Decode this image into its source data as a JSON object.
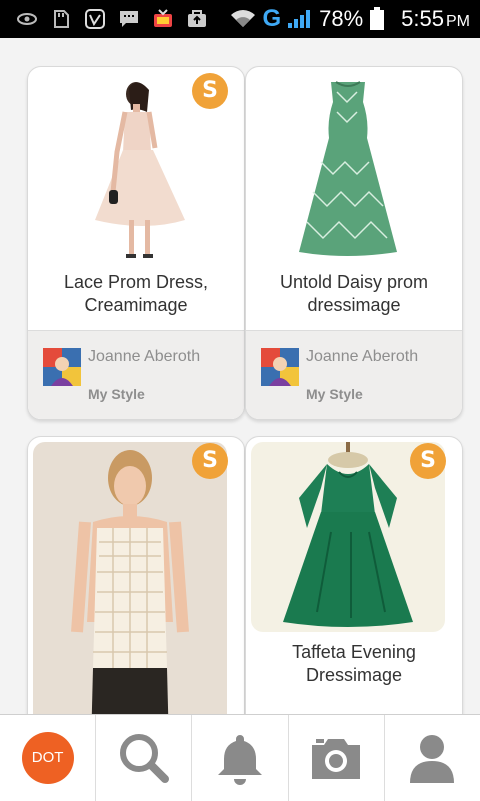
{
  "status_bar": {
    "battery": "78%",
    "time": "5:55",
    "ampm": "PM",
    "network": "G",
    "left_icons": [
      "eye-icon",
      "sd-card-icon",
      "vine-icon",
      "message-icon",
      "tv-app-icon",
      "briefcase-upload-icon"
    ],
    "right_icons": [
      "wifi-icon",
      "signal-icon",
      "battery-icon"
    ]
  },
  "feed": {
    "cards": [
      {
        "title": "Lace Prom Dress, Creamimage",
        "badge": "S",
        "author": "Joanne Aberoth",
        "board": "My Style",
        "image": "pink-lace-dress-model"
      },
      {
        "title": "Untold Daisy prom dressimage",
        "badge": "S",
        "author": "Joanne Aberoth",
        "board": "My Style",
        "image": "green-daisy-dress"
      },
      {
        "title": "",
        "badge": "S",
        "image": "cream-lace-top-model"
      },
      {
        "title": "Taffeta Evening Dressimage",
        "badge": "S",
        "image": "green-taffeta-dress"
      }
    ]
  },
  "bottom_nav": {
    "items": [
      {
        "label": "DOT",
        "icon": "dot-logo"
      },
      {
        "icon": "search-icon"
      },
      {
        "icon": "bell-icon"
      },
      {
        "icon": "camera-icon"
      },
      {
        "icon": "profile-icon"
      }
    ]
  },
  "colors": {
    "badge": "#f0a238",
    "dot_button": "#ee6123",
    "nav_icon": "#8a8a8a",
    "network": "#3fa9f5"
  }
}
